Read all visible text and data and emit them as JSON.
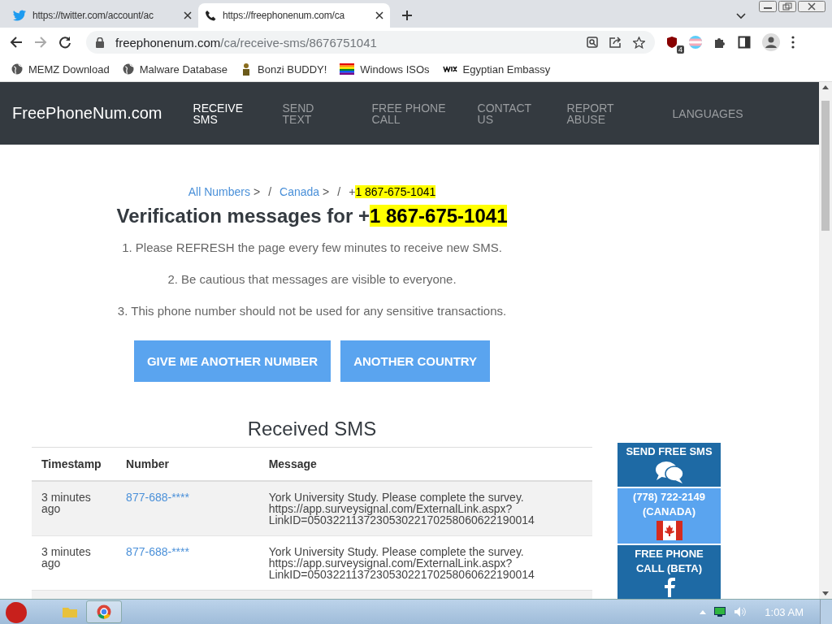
{
  "browser": {
    "tabs": [
      {
        "title": "https://twitter.com/account/ac",
        "selected": false
      },
      {
        "title": "https://freephonenum.com/ca",
        "selected": true
      }
    ],
    "address": {
      "host": "freephonenum.com",
      "path": "/ca/receive-sms/8676751041"
    },
    "extension_badge": "4",
    "bookmarks": [
      {
        "label": "MEMZ Download",
        "kind": "globe"
      },
      {
        "label": "Malware Database",
        "kind": "globe"
      },
      {
        "label": "Bonzi BUDDY!",
        "kind": "figure"
      },
      {
        "label": "Windows ISOs",
        "kind": "rainbow"
      },
      {
        "label": "Egyptian Embassy",
        "kind": "wix"
      }
    ]
  },
  "site": {
    "logo": "FreePhoneNum.com",
    "nav": [
      {
        "label": "RECEIVE SMS",
        "selected": true
      },
      {
        "label": "SEND TEXT",
        "selected": false
      },
      {
        "label": "FREE PHONE CALL",
        "selected": false
      },
      {
        "label": "CONTACT US",
        "selected": false
      },
      {
        "label": "REPORT ABUSE",
        "selected": false
      },
      {
        "label": "LANGUAGES",
        "selected": false
      }
    ],
    "breadcrumb": [
      {
        "label": "All Numbers",
        "sep": ">",
        "divider": "/"
      },
      {
        "label": "Canada",
        "sep": ">",
        "divider": "/"
      }
    ],
    "breadcrumb_prefix": "+",
    "breadcrumb_current": "1 867-675-1041",
    "heading": "Verification messages for +",
    "heading_number": "1 867-675-1041",
    "notes": [
      "1. Please REFRESH the page every few minutes to receive new SMS.",
      "2. Be cautious that messages are visible to everyone.",
      "3. This phone number should not be used for any sensitive transactions."
    ],
    "buttons": [
      "GIVE ME ANOTHER NUMBER",
      "ANOTHER COUNTRY"
    ],
    "table": {
      "title": "Received SMS",
      "columns": [
        "Timestamp",
        "Number",
        "Message"
      ],
      "rows": [
        {
          "timestamp": "3 minutes ago",
          "number": "877-688-****",
          "message": "York University Study. Please complete the survey. https://app.surveysignal.com/ExternalLink.aspx?LinkID=050322113723053022170258060622190014"
        },
        {
          "timestamp": "3 minutes ago",
          "number": "877-688-****",
          "message": "York University Study. Please complete the survey. https://app.surveysignal.com/ExternalLink.aspx?LinkID=050322113723053022170258060622190014"
        }
      ]
    },
    "sidebar": [
      {
        "kind": "sms",
        "title": "SEND FREE SMS"
      },
      {
        "kind": "number",
        "title": "(778) 722-2149 (CANADA)"
      },
      {
        "kind": "call",
        "title": "FREE PHONE CALL (BETA)"
      }
    ]
  },
  "taskbar": {
    "time": "1:03 AM"
  }
}
